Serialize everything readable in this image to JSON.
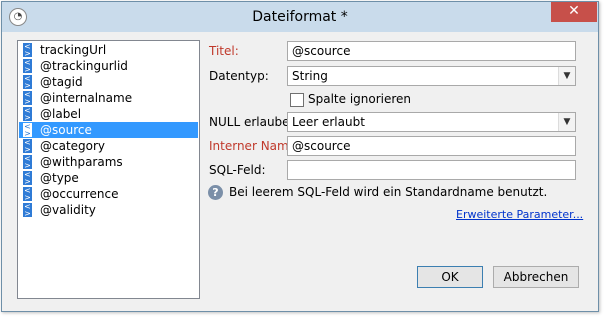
{
  "window": {
    "title": "Dateiformat *",
    "close_label": "✕"
  },
  "fields_list": {
    "items": [
      "trackingUrl",
      "@trackingurlid",
      "@tagid",
      "@internalname",
      "@label",
      "@source",
      "@category",
      "@withparams",
      "@type",
      "@occurrence",
      "@validity"
    ],
    "selected": "@source"
  },
  "form": {
    "title_label": "Titel:",
    "title_value": "@scource",
    "datatype_label": "Datentyp:",
    "datatype_value": "String",
    "ignore_column_label": "Spalte ignorieren",
    "ignore_column_checked": false,
    "null_label": "NULL erlauben:",
    "null_value": "Leer erlaubt",
    "internal_name_label": "Interner Name:",
    "internal_name_value": "@scource",
    "sql_field_label": "SQL-Feld:",
    "sql_field_value": "",
    "info_text": "Bei leerem SQL-Feld wird ein Standardname benutzt.",
    "advanced_link": "Erweiterte Parameter..."
  },
  "buttons": {
    "ok": "OK",
    "cancel": "Abbrechen"
  },
  "colors": {
    "selection": "#3399ff",
    "required_label": "#c0392b",
    "link": "#0033cc",
    "close": "#c7504a"
  },
  "icons": {
    "app": "app-icon",
    "field_item": "xml-attribute-icon",
    "info": "info-icon",
    "dropdown": "chevron-down-icon"
  }
}
